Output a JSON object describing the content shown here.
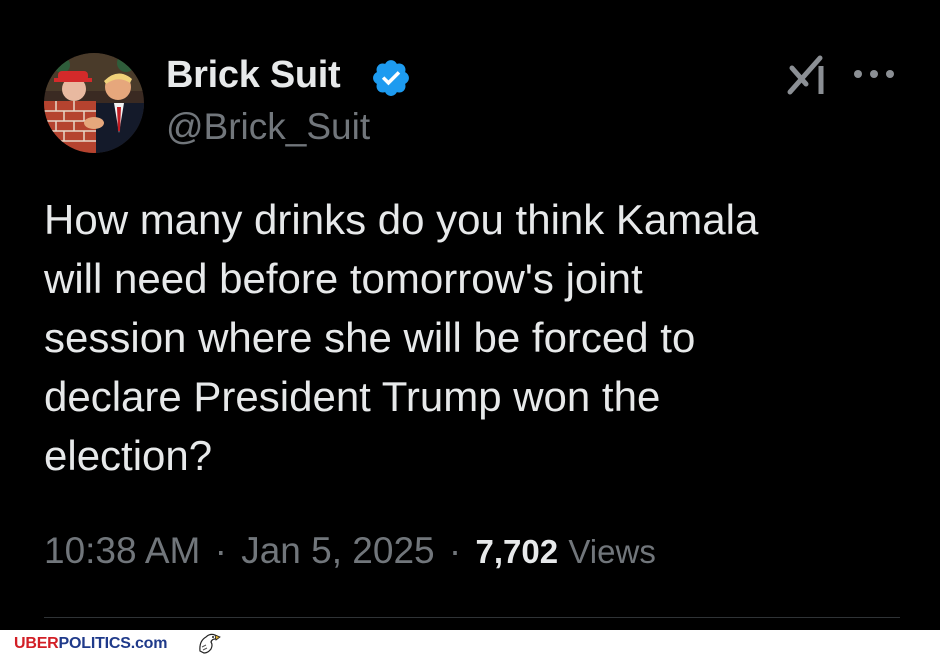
{
  "tweet": {
    "display_name": "Brick Suit",
    "handle": "@Brick_Suit",
    "text": "How many drinks do you think Kamala\nwill need before tomorrow's joint\nsession where she will be forced to\ndeclare President Trump won the\nelection?",
    "time": "10:38 AM",
    "separator": "·",
    "date": "Jan 5, 2025",
    "views_count": "7,702",
    "views_label": "Views",
    "icons": {
      "verified": "verified-badge-icon",
      "grok": "grok-icon",
      "more": "more-options-icon"
    }
  },
  "footer": {
    "brand_part1": "UBER",
    "brand_part2": "POLITICS.com",
    "logo_icon": "eagle-icon"
  },
  "colors": {
    "background": "#000000",
    "primary_text": "#e7e9ea",
    "secondary_text": "#71767b",
    "verified_blue": "#1d9bf0",
    "footer_red": "#d21f26",
    "footer_blue": "#1f3a8a"
  }
}
